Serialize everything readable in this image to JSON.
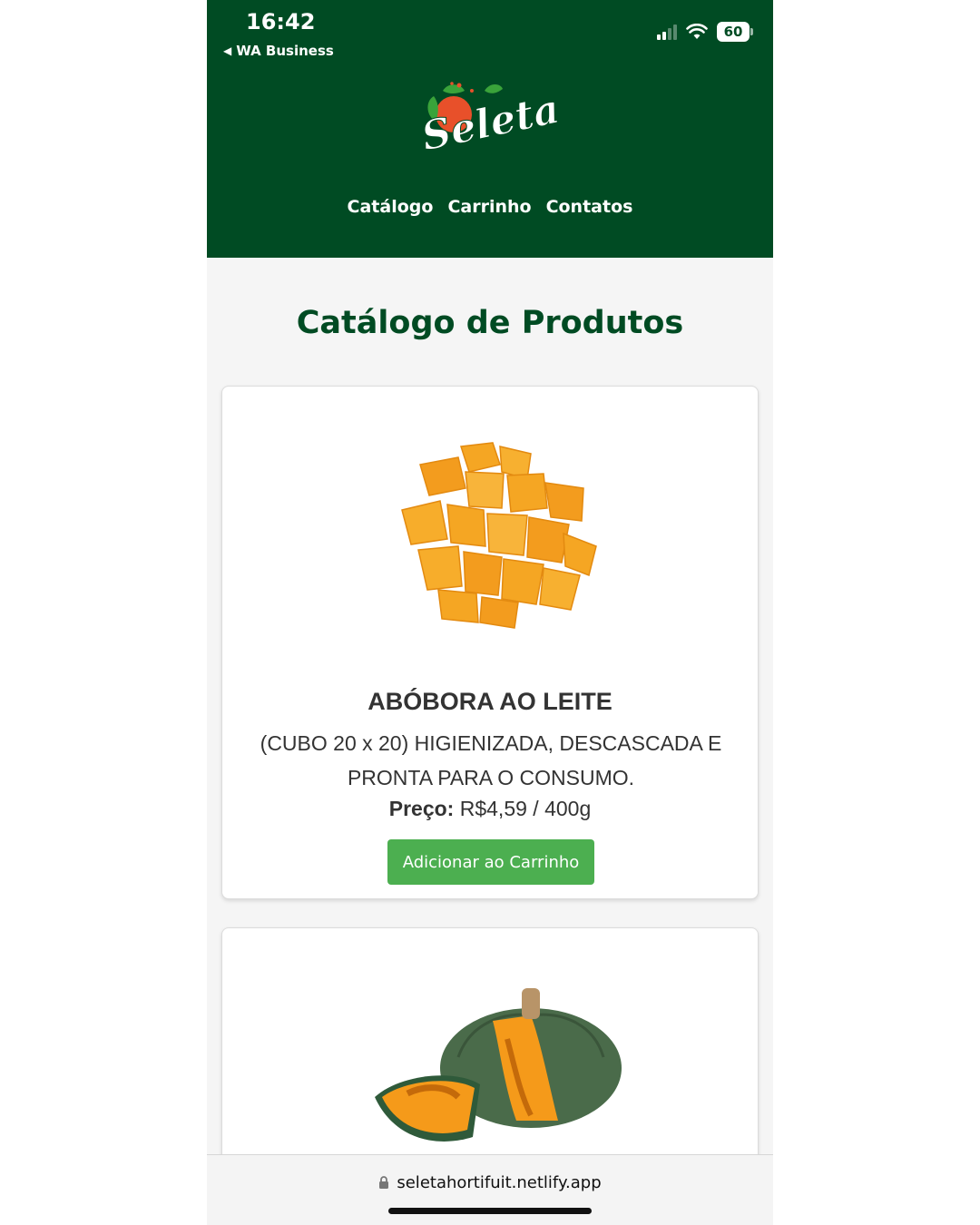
{
  "status_bar": {
    "time": "16:42",
    "back_app": "WA Business",
    "battery": "60",
    "signal_bars": 2
  },
  "header": {
    "logo_text": "Seleta",
    "brand_color": "#004b23",
    "nav": [
      "Catálogo",
      "Carrinho",
      "Contatos"
    ]
  },
  "main": {
    "title": "Catálogo de Produtos",
    "products": [
      {
        "name": "ABÓBORA AO LEITE",
        "description": "(CUBO 20 x 20) HIGIENIZADA, DESCASCADA E PRONTA PARA O CONSUMO.",
        "price_label": "Preço:",
        "price": " R$4,59 / 400g",
        "button": "Adicionar ao Carrinho",
        "image": "pumpkin-cubes"
      },
      {
        "image": "cabotia-pumpkin"
      }
    ]
  },
  "browser": {
    "url": "seletahortifuit.netlify.app",
    "button_color": "#4caf50"
  }
}
